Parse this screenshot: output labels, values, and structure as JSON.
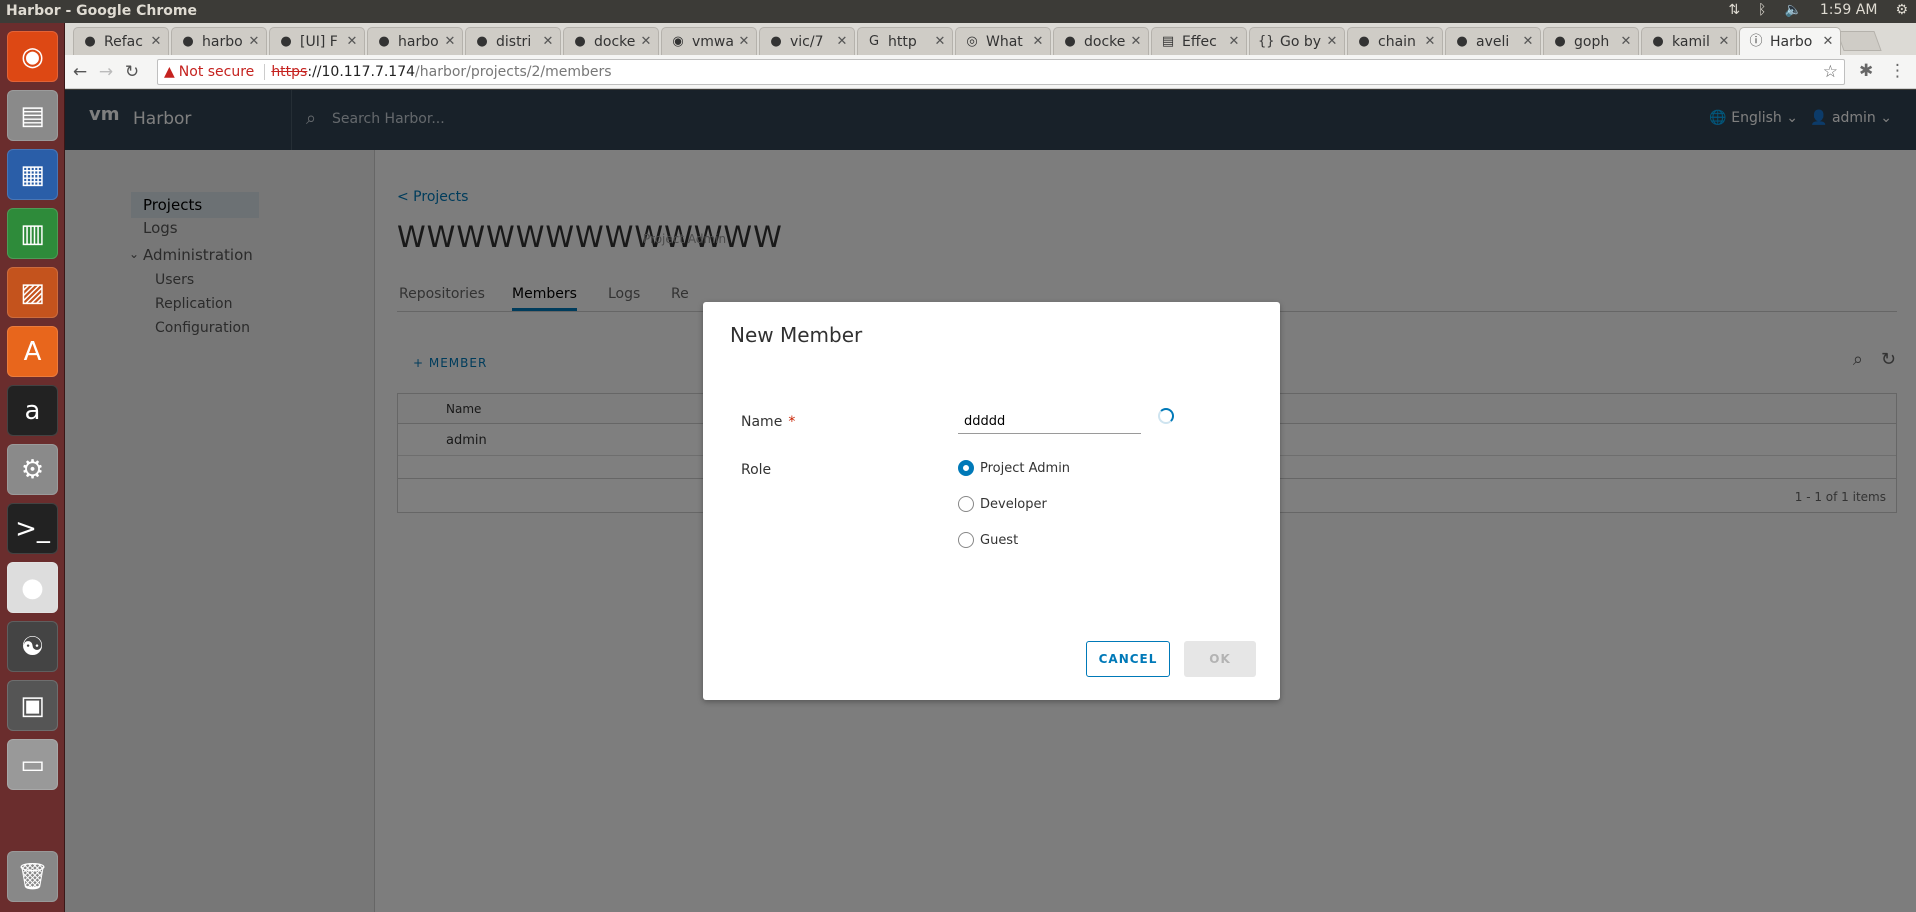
{
  "window": {
    "title": "Harbor - Google Chrome"
  },
  "tray": {
    "time": "1:59 AM"
  },
  "launcher": {
    "items": [
      {
        "name": "ubuntu-dash-icon",
        "glyph": "◉"
      },
      {
        "name": "files-icon",
        "glyph": "▤"
      },
      {
        "name": "writer-icon",
        "glyph": "▦"
      },
      {
        "name": "calc-icon",
        "glyph": "▥"
      },
      {
        "name": "impress-icon",
        "glyph": "▨"
      },
      {
        "name": "software-center-icon",
        "glyph": "A"
      },
      {
        "name": "amazon-icon",
        "glyph": "a"
      },
      {
        "name": "settings-icon",
        "glyph": "⚙"
      },
      {
        "name": "terminal-icon",
        "glyph": ">_"
      },
      {
        "name": "chrome-icon",
        "glyph": "●"
      },
      {
        "name": "yinyang-icon",
        "glyph": "☯"
      },
      {
        "name": "floppy-icon",
        "glyph": "▣"
      },
      {
        "name": "drive-icon",
        "glyph": "▭"
      },
      {
        "name": "trash-icon",
        "glyph": "🗑"
      }
    ]
  },
  "tabs": [
    {
      "label": "Refac",
      "icon": "github"
    },
    {
      "label": "harbo",
      "icon": "github"
    },
    {
      "label": "[UI] F",
      "icon": "github"
    },
    {
      "label": "harbo",
      "icon": "github"
    },
    {
      "label": "distri",
      "icon": "github"
    },
    {
      "label": "docke",
      "icon": "github"
    },
    {
      "label": "vmwa",
      "icon": "eye"
    },
    {
      "label": "vic/7",
      "icon": "github"
    },
    {
      "label": "http",
      "icon": "google"
    },
    {
      "label": "What",
      "icon": "circle"
    },
    {
      "label": "docke",
      "icon": "github"
    },
    {
      "label": "Effec",
      "icon": "doc"
    },
    {
      "label": "Go by",
      "icon": "code"
    },
    {
      "label": "chain",
      "icon": "github"
    },
    {
      "label": "aveli",
      "icon": "github"
    },
    {
      "label": "goph",
      "icon": "github"
    },
    {
      "label": "kamil",
      "icon": "github"
    },
    {
      "label": "Harbo",
      "icon": "info",
      "active": true
    }
  ],
  "address": {
    "not_secure": "Not secure",
    "scheme": "https",
    "rest_host": "://10.117.7.174",
    "path": "/harbor/projects/2/members"
  },
  "harbor": {
    "brand": "Harbor",
    "logo": "vm",
    "search_placeholder": "Search Harbor...",
    "language": "English",
    "user": "admin"
  },
  "sidebar": {
    "projects": "Projects",
    "logs": "Logs",
    "administration": "Administration",
    "users": "Users",
    "replication": "Replication",
    "configuration": "Configuration"
  },
  "project": {
    "back": "< Projects",
    "name": "WWWWWWWWWWWWW",
    "tag": "Project Admin",
    "tabs": [
      "Repositories",
      "Members",
      "Logs",
      "Re"
    ],
    "add_member": "+ MEMBER",
    "col_name": "Name",
    "row_name": "admin",
    "footer": "1 - 1 of 1 items"
  },
  "modal": {
    "title": "New Member",
    "name_label": "Name",
    "required_mark": "*",
    "name_value": "ddddd",
    "role_label": "Role",
    "roles": [
      "Project Admin",
      "Developer",
      "Guest"
    ],
    "selected_role": "Project Admin",
    "cancel": "CANCEL",
    "ok": "OK"
  }
}
